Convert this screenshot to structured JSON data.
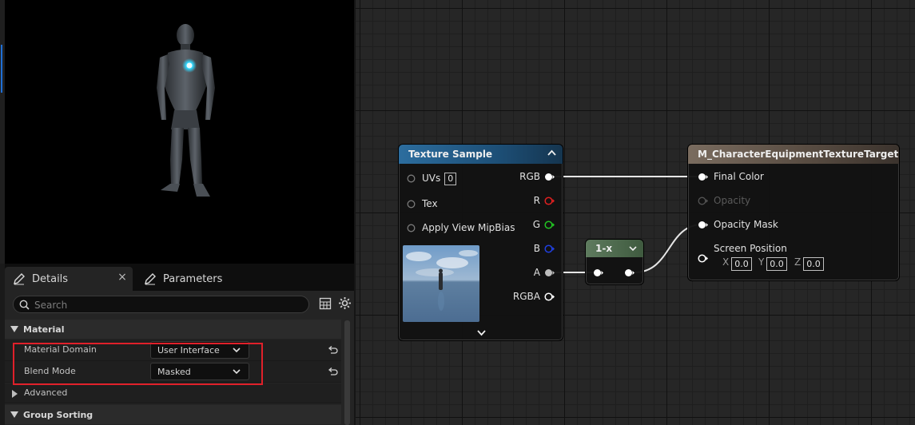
{
  "details_panel": {
    "tab_details_label": "Details",
    "tab_close_glyph": "×",
    "tab_parameters_label": "Parameters",
    "search_placeholder": "Search",
    "categories": {
      "material": "Material",
      "group_sorting": "Group Sorting"
    },
    "properties": {
      "material_domain": {
        "label": "Material Domain",
        "value": "User Interface"
      },
      "blend_mode": {
        "label": "Blend Mode",
        "value": "Masked"
      },
      "advanced_label": "Advanced"
    }
  },
  "graph": {
    "texture_sample": {
      "title": "Texture Sample",
      "inputs": {
        "uvs": "UVs",
        "uvs_value": "0",
        "tex": "Tex",
        "mip_bias": "Apply View MipBias"
      },
      "outputs": {
        "rgb": "RGB",
        "r": "R",
        "g": "G",
        "b": "B",
        "a": "A",
        "rgba": "RGBA"
      }
    },
    "one_minus": {
      "title": "1-x"
    },
    "result_node": {
      "title": "M_CharacterEquipmentTextureTarget",
      "inputs": {
        "final_color": "Final Color",
        "opacity": "Opacity",
        "opacity_mask": "Opacity Mask",
        "screen_position": "Screen Position"
      },
      "coords": {
        "x_label": "X",
        "x_value": "0.0",
        "y_label": "Y",
        "y_value": "0.0",
        "z_label": "Z",
        "z_value": "0.0"
      }
    }
  },
  "colors": {
    "pin_red": "#e02020",
    "pin_green": "#22c422",
    "pin_blue": "#2040e0",
    "highlight_red": "#e0202a",
    "emissive_cyan": "#2fd8ff"
  }
}
